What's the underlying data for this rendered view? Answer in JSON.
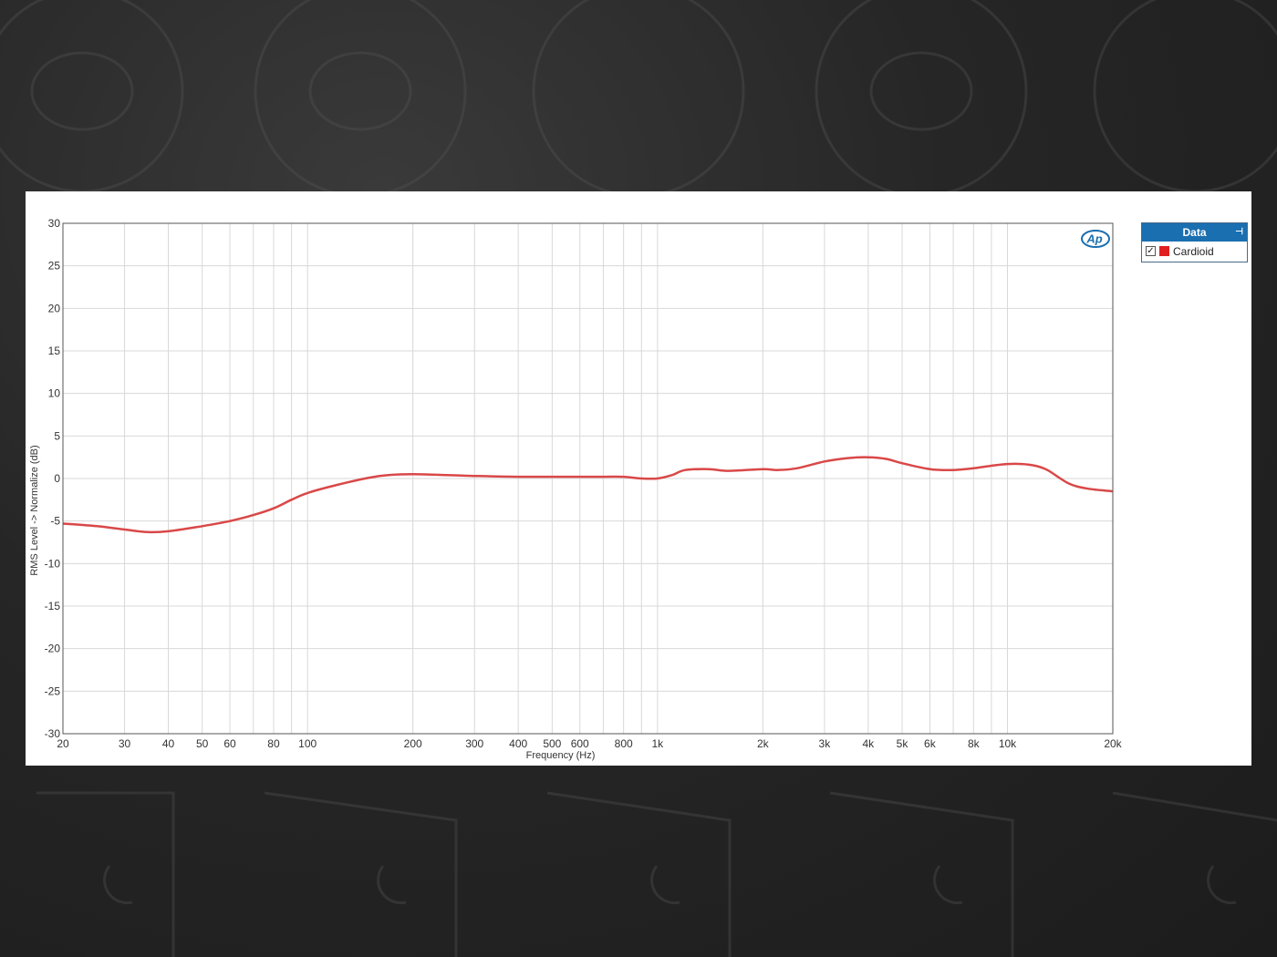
{
  "legend": {
    "header": "Data",
    "pin_glyph": "⊣",
    "check_glyph": "✓",
    "items": [
      {
        "label": "Cardioid",
        "color": "#e02020"
      }
    ]
  },
  "logo": {
    "text": "Ap"
  },
  "chart_data": {
    "type": "line",
    "title": "",
    "xlabel": "Frequency (Hz)",
    "ylabel": "RMS Level -> Normalize (dB)",
    "xscale": "log",
    "xlim": [
      20,
      20000
    ],
    "ylim": [
      -30,
      30
    ],
    "grid": true,
    "legend_position": "top-right outside",
    "x_ticks": [
      20,
      30,
      40,
      50,
      60,
      80,
      100,
      200,
      300,
      400,
      500,
      600,
      800,
      1000,
      2000,
      3000,
      4000,
      5000,
      6000,
      8000,
      10000,
      20000
    ],
    "x_tick_labels": [
      "20",
      "30",
      "40",
      "50",
      "60",
      "80",
      "100",
      "200",
      "300",
      "400",
      "500",
      "600",
      "800",
      "1k",
      "2k",
      "3k",
      "4k",
      "5k",
      "6k",
      "8k",
      "10k",
      "20k"
    ],
    "y_ticks": [
      30,
      25,
      20,
      15,
      10,
      5,
      0,
      -5,
      -10,
      -15,
      -20,
      -25,
      -30
    ],
    "y_tick_labels": [
      "30",
      "25",
      "20",
      "15",
      "10",
      "5",
      "0",
      "-5",
      "-10",
      "-15",
      "-20",
      "-25",
      "-30"
    ],
    "series": [
      {
        "name": "Cardioid",
        "color": "#d94848",
        "x": [
          20,
          25,
          30,
          35,
          40,
          50,
          60,
          70,
          80,
          90,
          100,
          120,
          150,
          170,
          200,
          250,
          300,
          400,
          500,
          600,
          700,
          800,
          900,
          1000,
          1100,
          1200,
          1400,
          1600,
          2000,
          2200,
          2500,
          3000,
          3500,
          4000,
          4500,
          5000,
          6000,
          7000,
          8000,
          9000,
          10000,
          11000,
          12000,
          13000,
          15000,
          17000,
          20000
        ],
        "y": [
          -5.3,
          -5.6,
          -6.0,
          -6.3,
          -6.2,
          -5.6,
          -5.0,
          -4.3,
          -3.5,
          -2.5,
          -1.7,
          -0.8,
          0.1,
          0.4,
          0.5,
          0.4,
          0.3,
          0.2,
          0.2,
          0.2,
          0.2,
          0.2,
          0.0,
          0.0,
          0.4,
          1.0,
          1.1,
          0.9,
          1.1,
          1.0,
          1.2,
          2.0,
          2.4,
          2.5,
          2.3,
          1.8,
          1.1,
          1.0,
          1.2,
          1.5,
          1.7,
          1.7,
          1.5,
          1.0,
          -0.6,
          -1.2,
          -1.5
        ]
      }
    ]
  }
}
